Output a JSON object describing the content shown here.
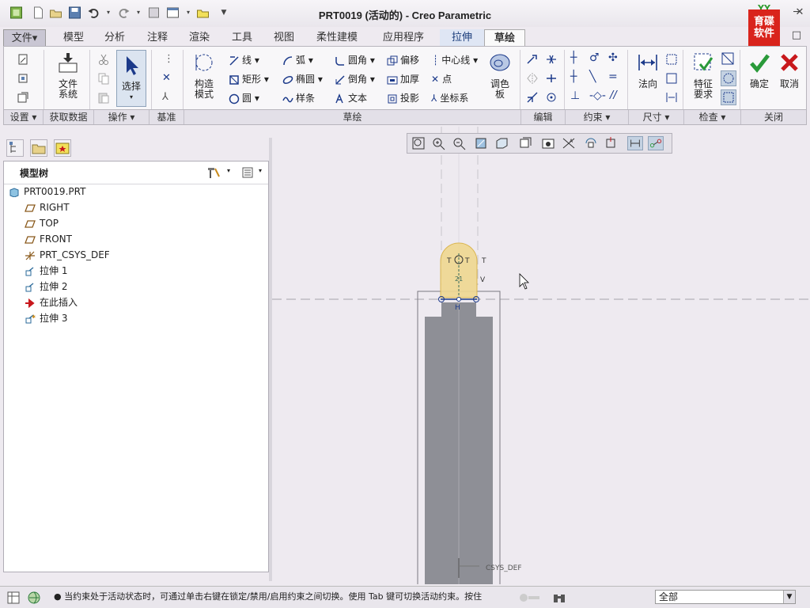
{
  "window": {
    "title": "PRT0019 (活动的) - Creo Parametric",
    "logo_top": "YY",
    "logo_text": "育碟\n软件"
  },
  "tabs": [
    {
      "label": "文件▾"
    },
    {
      "label": "模型"
    },
    {
      "label": "分析"
    },
    {
      "label": "注释"
    },
    {
      "label": "渲染"
    },
    {
      "label": "工具"
    },
    {
      "label": "视图"
    },
    {
      "label": "柔性建模"
    },
    {
      "label": "应用程序"
    },
    {
      "label": "拉伸"
    },
    {
      "label": "草绘"
    }
  ],
  "ribbon": {
    "file_system": "文件\n系统",
    "select": "选择",
    "construct_mode": "构造\n模式",
    "line": "线",
    "rectangle": "矩形",
    "circle": "圆",
    "arc": "弧",
    "ellipse": "椭圆",
    "spline": "样条",
    "fillet": "圆角",
    "chamfer": "倒角",
    "text": "文本",
    "offset": "偏移",
    "thicken": "加厚",
    "project": "投影",
    "centerline": "中心线",
    "point": "点",
    "csys": "坐标系",
    "palette": "调色\n板",
    "normal": "法向",
    "feature_req": "特征\n要求",
    "ok": "确定",
    "cancel": "取消"
  },
  "groups": [
    {
      "label": "设置 ▾"
    },
    {
      "label": "获取数据"
    },
    {
      "label": "操作 ▾"
    },
    {
      "label": "基准"
    },
    {
      "label": "草绘"
    },
    {
      "label": "编辑"
    },
    {
      "label": "约束 ▾"
    },
    {
      "label": "尺寸 ▾"
    },
    {
      "label": "检查 ▾"
    },
    {
      "label": "关闭"
    }
  ],
  "model_tree": {
    "title": "模型树",
    "items": [
      {
        "label": "PRT0019.PRT",
        "icon": "part-icon"
      },
      {
        "label": "RIGHT",
        "icon": "datum-plane-icon"
      },
      {
        "label": "TOP",
        "icon": "datum-plane-icon"
      },
      {
        "label": "FRONT",
        "icon": "datum-plane-icon"
      },
      {
        "label": "PRT_CSYS_DEF",
        "icon": "csys-icon"
      },
      {
        "label": "拉伸 1",
        "icon": "extrude-icon"
      },
      {
        "label": "拉伸 2",
        "icon": "extrude-icon"
      },
      {
        "label": "在此插入",
        "icon": "insert-arrow-icon"
      },
      {
        "label": "拉伸 3",
        "icon": "extrude-icon"
      }
    ]
  },
  "canvas": {
    "csys_label": "CSYS_DEF",
    "dim_label": "21",
    "constraint_t": "T",
    "constraint_v": "V",
    "constraint_h": "H"
  },
  "status": {
    "message": "● 当约束处于活动状态时，可通过单击右键在锁定/禁用/启用约束之间切换。使用 Tab 键可切换活动约束。按住",
    "filter": "全部"
  },
  "colors": {
    "background": "#eeeaf0",
    "part_fill": "#8e8f96",
    "sketch_highlight": "#f0d890",
    "ok_green": "#2a9a3a",
    "cancel_red": "#c8181c"
  }
}
